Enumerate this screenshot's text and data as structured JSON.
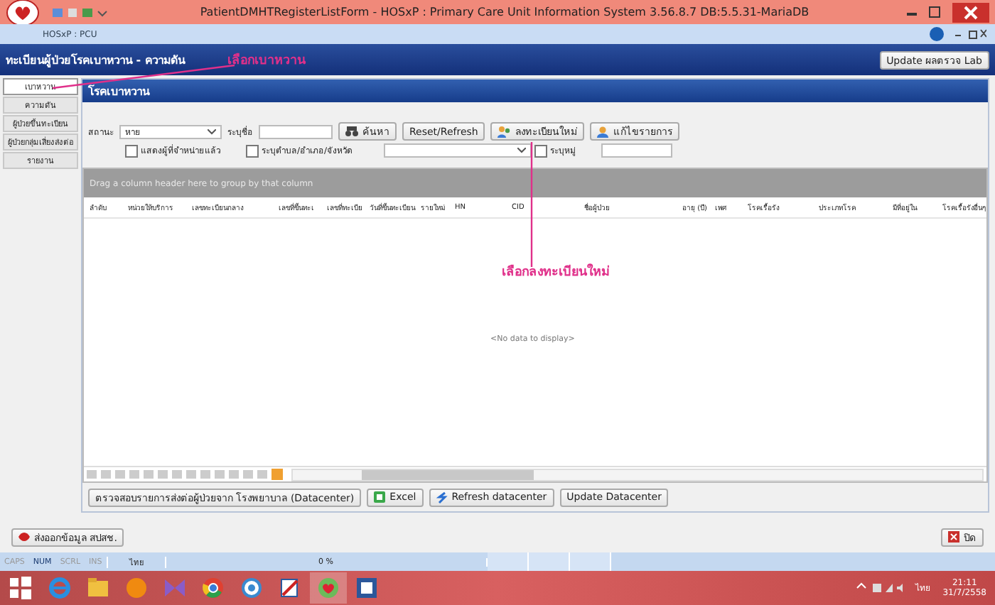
{
  "window": {
    "title": "PatientDMHTRegisterListForm -  HOSxP : Primary Care Unit Information System 3.56.8.7 DB:5.5.31-MariaDB",
    "app_label": "HOSxP : PCU"
  },
  "header": {
    "title": "ทะเบียนผู้ป่วยโรคเบาหวาน - ความดัน",
    "update_button": "Update ผลตรวจ Lab"
  },
  "annotations": [
    {
      "text": "เลือกเบาหวาน"
    },
    {
      "text": "เลือกลงทะเบียนใหม่"
    }
  ],
  "sidebar": {
    "items": [
      {
        "label": "เบาหวาน",
        "selected": true
      },
      {
        "label": "ความดัน",
        "selected": false
      },
      {
        "label": "ผู้ป่วยขึ้นทะเบียน",
        "selected": false
      },
      {
        "label": "ผู้ป่วยกลุ่มเสี่ยงส่งต่อ",
        "selected": false
      },
      {
        "label": "รายงาน",
        "selected": false
      }
    ]
  },
  "panel": {
    "title": "โรคเบาหวาน",
    "filters": {
      "status_label": "สถานะ",
      "status_value": "หาย",
      "name_label": "ระบุชื่อ",
      "search_button": "ค้นหา",
      "reset_button": "Reset/Refresh",
      "register_button": "ลงทะเบียนใหม่",
      "edit_button": "แก้ไขรายการ",
      "checkboxes": [
        {
          "label": "แสดงผู้ที่จำหน่ายแล้ว",
          "checked": false
        },
        {
          "label": "ระบุตำบล/อำเภอ/จังหวัด",
          "checked": false
        },
        {
          "label": "ระบุหมู่",
          "checked": false
        }
      ]
    },
    "group_hint": "Drag a column header here to group by that column",
    "columns": [
      "ลำดับ",
      "หน่วยให้บริการ",
      "เลขทะเบียนกลาง",
      "เลขที่ขึ้นทะเ",
      "เลขที่ทะเบีย",
      "วันที่ขึ้นทะเบียน",
      "รายใหม่",
      "HN",
      "CID",
      "ชื่อผู้ป่วย",
      "อายุ (ปี)",
      "เพศ",
      "โรคเรื้อรัง",
      "ประเภทโรค",
      "มีที่อยู่ใน",
      "โรคเรื้อรังอื่นๆ"
    ],
    "empty_text": "<No data to display>",
    "actions": [
      {
        "label": "ตรวจสอบรายการส่งต่อผู้ป่วยจาก โรงพยาบาล (Datacenter)",
        "kind": "plain"
      },
      {
        "label": "Excel",
        "kind": "excel"
      },
      {
        "label": "Refresh datacenter",
        "kind": "refresh"
      },
      {
        "label": "Update Datacenter",
        "kind": "plain"
      }
    ]
  },
  "footer": {
    "export_button": "ส่งออกข้อมูล สปสช.",
    "close_button": "ปิด"
  },
  "status_bar": {
    "keys": [
      {
        "text": "CAPS",
        "on": false
      },
      {
        "text": "NUM",
        "on": true
      },
      {
        "text": "SCRL",
        "on": false
      },
      {
        "text": "INS",
        "on": false
      }
    ],
    "language": "ไทย",
    "progress": "0 %"
  },
  "taskbar": {
    "language": "ไทย",
    "time": "21:11",
    "date": "31/7/2558"
  }
}
